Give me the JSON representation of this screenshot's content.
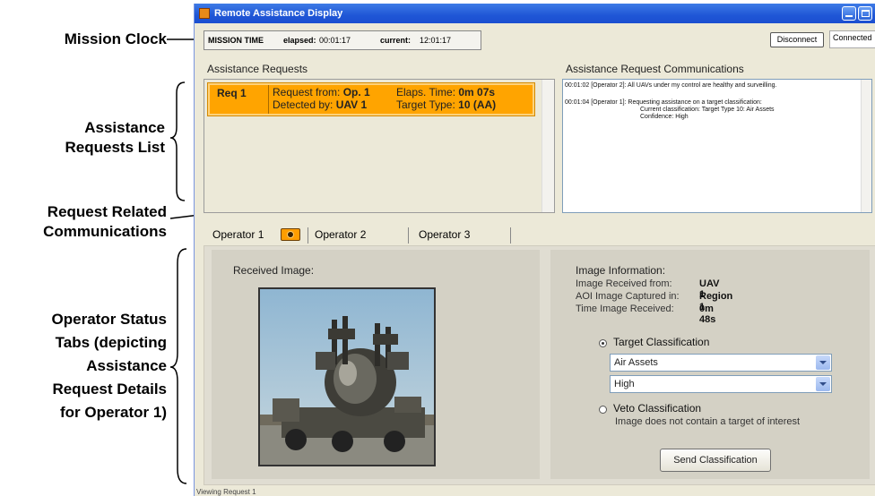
{
  "callouts": {
    "mission_clock": "Mission Clock",
    "assistance_requests_list": [
      "Assistance",
      "Requests List"
    ],
    "request_related_communications": [
      "Request Related",
      "Communications"
    ],
    "operator_status_tabs": [
      "Operator Status",
      "Tabs (depicting",
      "Assistance",
      "Request Details",
      "for Operator 1)"
    ]
  },
  "window": {
    "title": "Remote Assistance Display",
    "icon": "app-icon"
  },
  "mission": {
    "label": "MISSION TIME",
    "elapsed_label": "elapsed:",
    "elapsed_value": "00:01:17",
    "current_label": "current:",
    "current_value": "12:01:17"
  },
  "connection": {
    "disconnect_label": "Disconnect",
    "status": "Connected"
  },
  "requests": {
    "title": "Assistance Requests",
    "items": [
      {
        "id": "Req 1",
        "request_from_label": "Request from:",
        "request_from": "Op. 1",
        "detected_by_label": "Detected by:",
        "detected_by": "UAV 1",
        "elapsed_label": "Elaps. Time:",
        "elapsed": "0m 07s",
        "target_type_label": "Target Type:",
        "target_type": "10 (AA)"
      }
    ]
  },
  "communications": {
    "title": "Assistance Request Communications",
    "messages": [
      {
        "text": "00:01:02 [Operator 2]: All UAVs under my control are healthy and surveilling."
      },
      {
        "text": "00:01:04 [Operator 1]: Requesting assistance on a target classification:",
        "lines": [
          "Current classification:  Target Type 10: Air Assets",
          "Confidence: High"
        ]
      }
    ]
  },
  "tabs": [
    {
      "label": "Operator 1",
      "icon": "camera-icon",
      "active": true
    },
    {
      "label": "Operator 2",
      "active": false
    },
    {
      "label": "Operator 3",
      "active": false
    }
  ],
  "received_image": {
    "label": "Received Image:"
  },
  "image_info": {
    "title": "Image Information:",
    "received_from_label": "Image Received from:",
    "received_from": "UAV 1",
    "aoi_label": "AOI Image Captured in:",
    "aoi": "Region 1",
    "time_label": "Time Image Received:",
    "time": "0m 48s"
  },
  "classification": {
    "target_label": "Target Classification",
    "target_selected": true,
    "type_value": "Air Assets",
    "confidence_value": "High",
    "veto_label": "Veto Classification",
    "veto_desc": "Image does not contain a target of interest",
    "send_label": "Send Classification"
  },
  "status_bar": {
    "text": "Viewing Request 1"
  }
}
